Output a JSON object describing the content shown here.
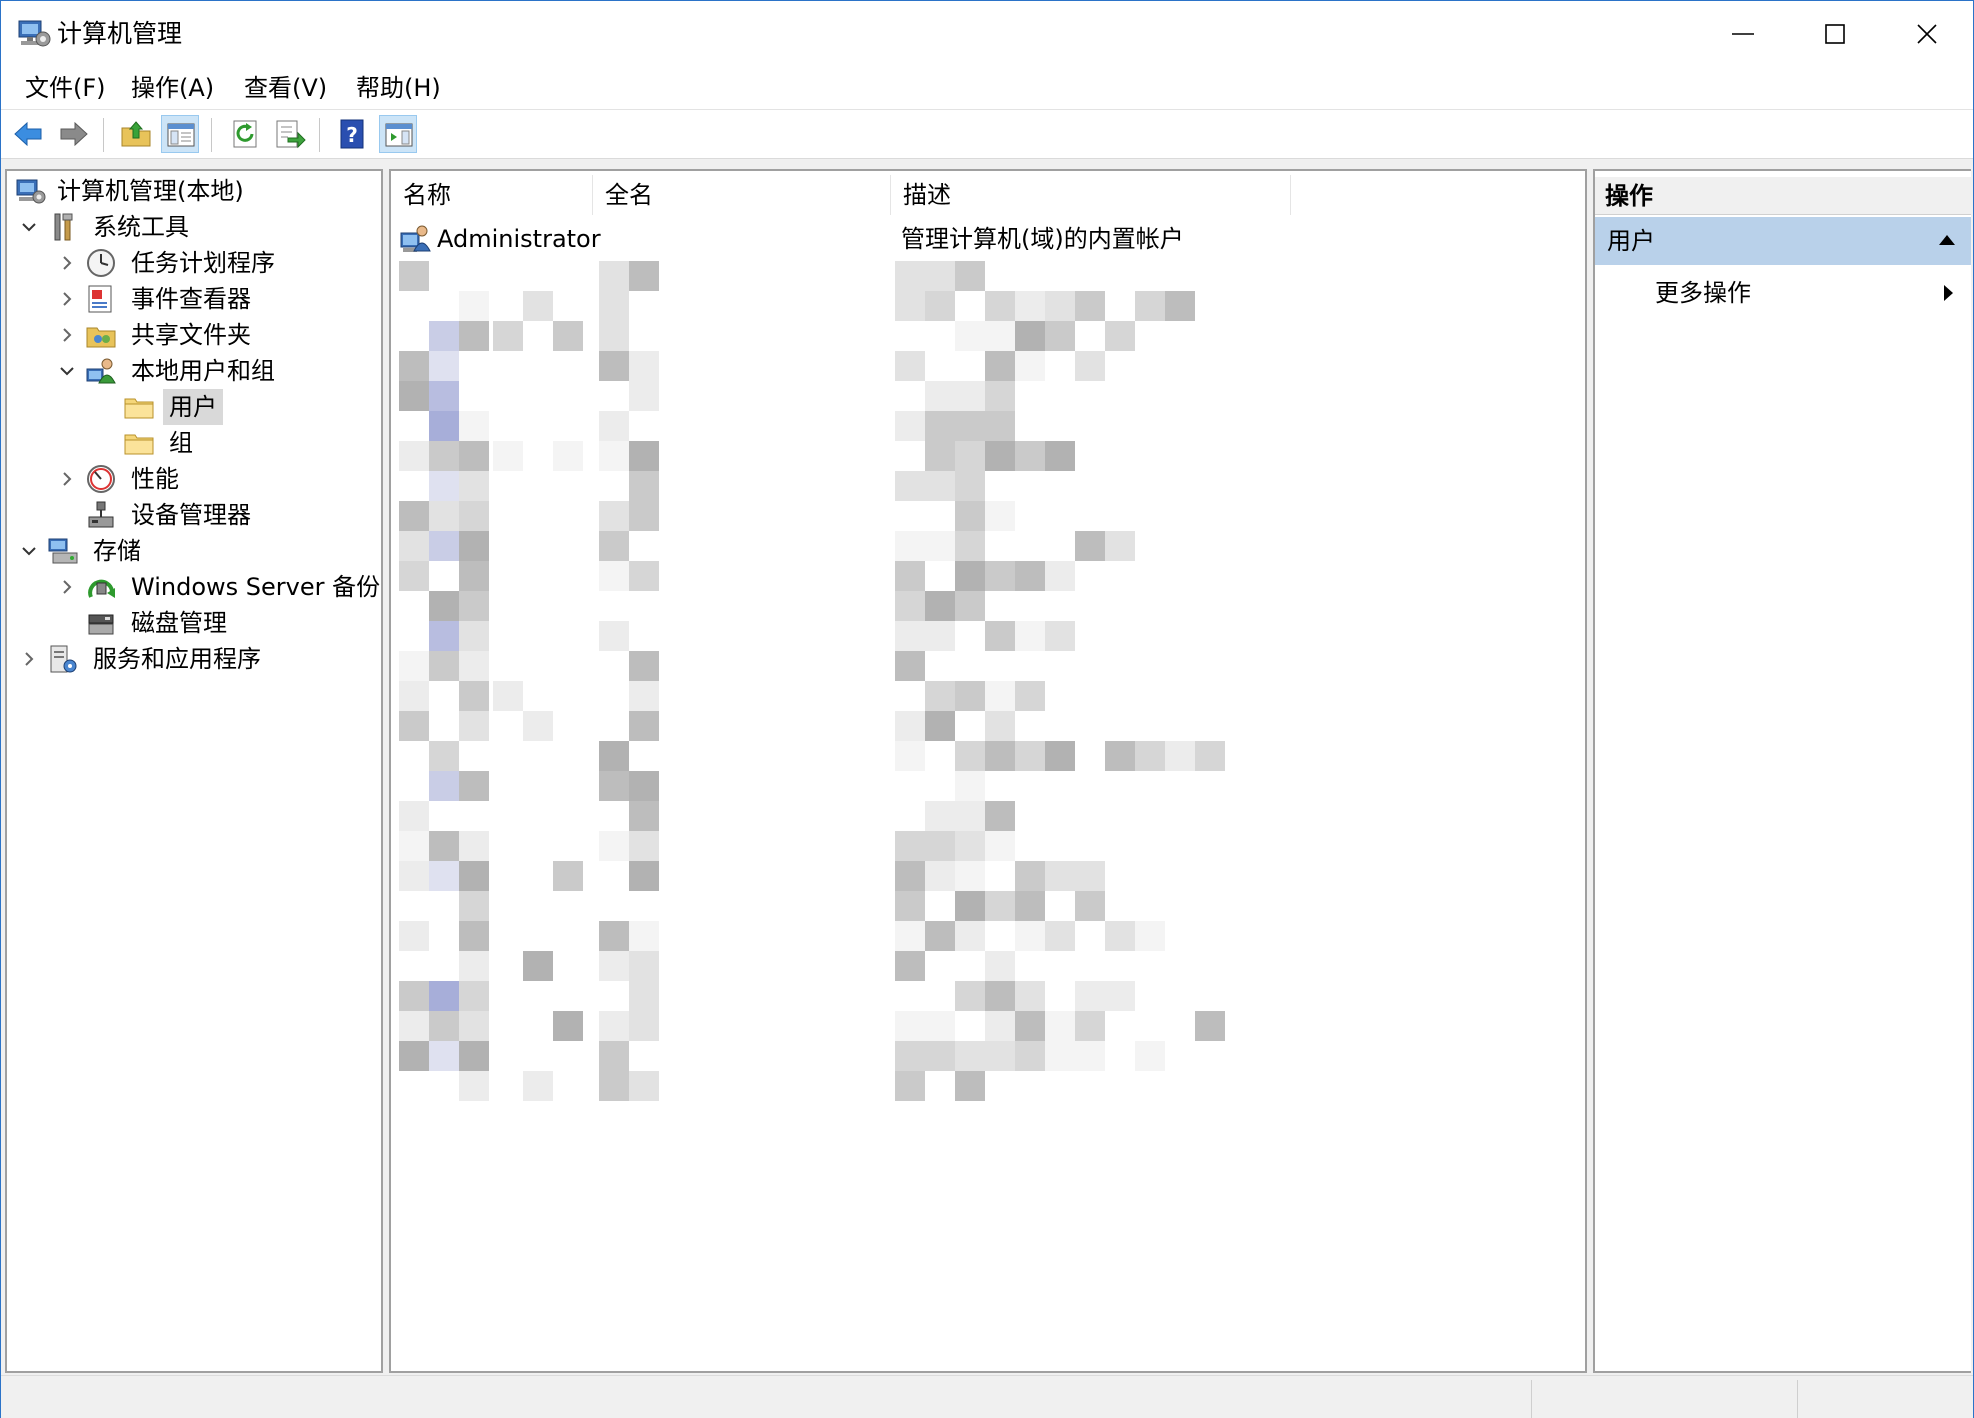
{
  "window": {
    "title": "计算机管理"
  },
  "menu": {
    "items": [
      "文件(F)",
      "操作(A)",
      "查看(V)",
      "帮助(H)"
    ]
  },
  "toolbar": {
    "buttons": [
      "back-icon",
      "forward-icon",
      "up-folder-icon",
      "show-hide-console-tree-icon",
      "refresh-icon",
      "export-list-icon",
      "help-icon",
      "show-hide-action-pane-icon"
    ]
  },
  "tree": {
    "items": [
      {
        "label": "计算机管理(本地)",
        "icon": "computer-management-icon",
        "level": 0,
        "expander": "none"
      },
      {
        "label": "系统工具",
        "icon": "system-tools-icon",
        "level": 1,
        "expander": "expanded"
      },
      {
        "label": "任务计划程序",
        "icon": "task-scheduler-icon",
        "level": 2,
        "expander": "collapsed"
      },
      {
        "label": "事件查看器",
        "icon": "event-viewer-icon",
        "level": 2,
        "expander": "collapsed"
      },
      {
        "label": "共享文件夹",
        "icon": "shared-folders-icon",
        "level": 2,
        "expander": "collapsed"
      },
      {
        "label": "本地用户和组",
        "icon": "local-users-groups-icon",
        "level": 2,
        "expander": "expanded"
      },
      {
        "label": "用户",
        "icon": "folder-icon",
        "level": 3,
        "expander": "none",
        "selected": true
      },
      {
        "label": "组",
        "icon": "folder-icon",
        "level": 3,
        "expander": "none"
      },
      {
        "label": "性能",
        "icon": "performance-icon",
        "level": 2,
        "expander": "collapsed"
      },
      {
        "label": "设备管理器",
        "icon": "device-manager-icon",
        "level": 2,
        "expander": "none"
      },
      {
        "label": "存储",
        "icon": "storage-icon",
        "level": 1,
        "expander": "expanded"
      },
      {
        "label": "Windows Server 备份",
        "icon": "windows-server-backup-icon",
        "level": 2,
        "expander": "collapsed"
      },
      {
        "label": "磁盘管理",
        "icon": "disk-management-icon",
        "level": 2,
        "expander": "none"
      },
      {
        "label": "服务和应用程序",
        "icon": "services-applications-icon",
        "level": 1,
        "expander": "collapsed"
      }
    ]
  },
  "list": {
    "columns": [
      "名称",
      "全名",
      "描述"
    ],
    "rows": [
      {
        "name": "Administrator",
        "full_name": "",
        "description": "管理计算机(域)的内置帐户",
        "icon": "user-icon"
      }
    ]
  },
  "actions": {
    "header": "操作",
    "section": "用户",
    "items": [
      "更多操作"
    ]
  },
  "colors": {
    "accent": "#2b73c8",
    "section_bg": "#b9d1ea",
    "selection": "#d9d9d9"
  }
}
